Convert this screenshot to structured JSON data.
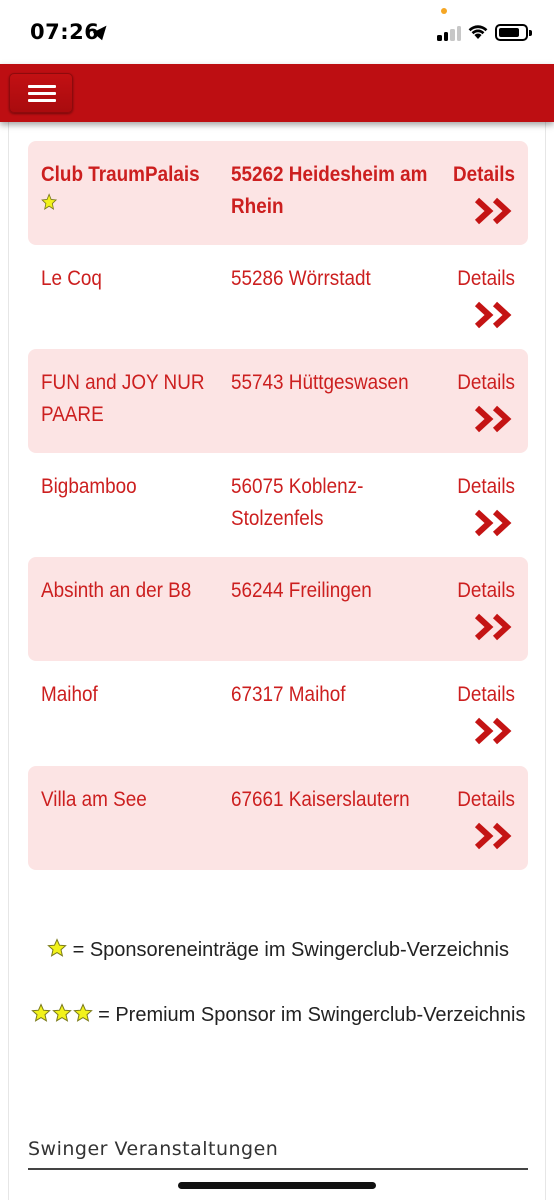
{
  "status_bar": {
    "time": "07:26"
  },
  "header": {
    "menu_icon": "hamburger-icon",
    "color": "#bd0e12"
  },
  "clubs": [
    {
      "name": "Club TraumPalais",
      "city": "55262 Heidesheim am Rhein",
      "details": "Details",
      "sponsor": "sponsor"
    },
    {
      "name": "Le Coq",
      "city": "55286 Wörrstadt",
      "details": "Details"
    },
    {
      "name": "FUN and JOY NUR PAARE",
      "city": "55743 Hüttgeswasen",
      "details": "Details"
    },
    {
      "name": "Bigbamboo",
      "city": "56075 Koblenz-Stolzenfels",
      "details": "Details"
    },
    {
      "name": "Absinth an der B8",
      "city": "56244 Freilingen",
      "details": "Details"
    },
    {
      "name": "Maihof",
      "city": "67317 Maihof",
      "details": "Details"
    },
    {
      "name": "Villa am See",
      "city": "67661 Kaiserslautern",
      "details": "Details"
    }
  ],
  "legend": {
    "sponsor": "= Sponsoreneinträge im Swingerclub-Verzeichnis",
    "premium": "= Premium Sponsor im Swingerclub-Verzeichnis"
  },
  "section_title": "Swinger Veranstaltungen",
  "colors": {
    "accent": "#cc1f1f",
    "row_shade": "#fce4e4",
    "star": "#f2f21a"
  }
}
